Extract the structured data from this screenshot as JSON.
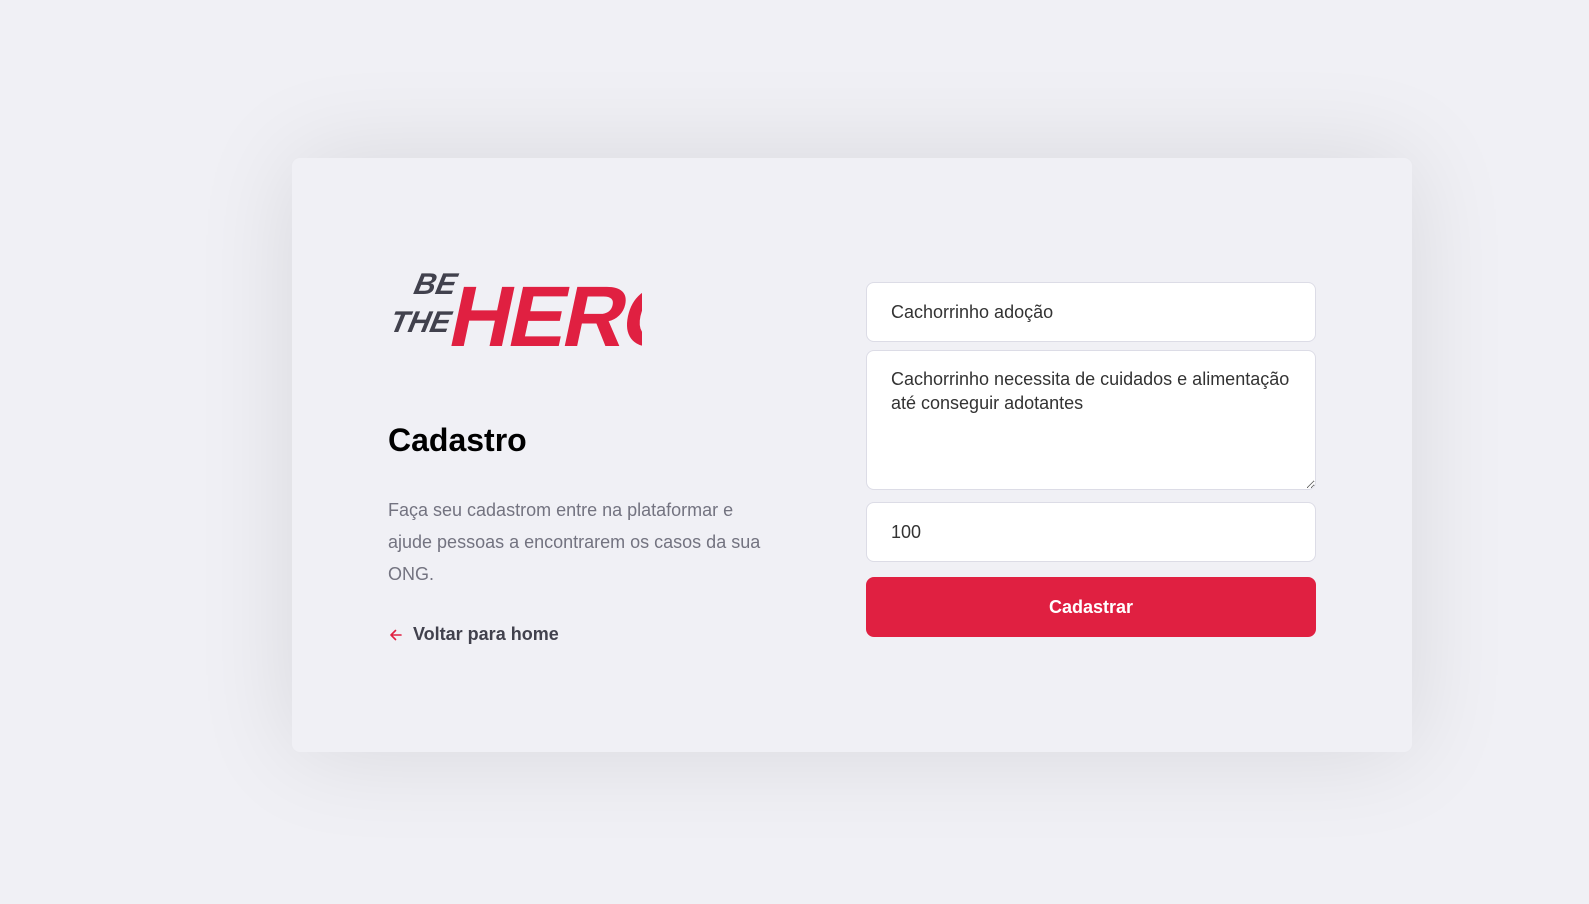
{
  "brand": {
    "logo_small_line1": "BE",
    "logo_small_line2": "THE",
    "logo_large": "HERO",
    "logo_dark_color": "#41414d",
    "logo_accent_color": "#e02041"
  },
  "page": {
    "title": "Cadastro",
    "description": "Faça seu cadastrom entre na plataformar e ajude pessoas a encontrarem os casos da sua ONG.",
    "back_link_label": "Voltar para home",
    "back_link_icon": "arrow-left-icon"
  },
  "form": {
    "title_value": "Cachorrinho adoção",
    "description_value": "Cachorrinho necessita de cuidados e alimentação até conseguir adotantes",
    "value_value": "100",
    "submit_label": "Cadastrar"
  },
  "colors": {
    "background": "#f0f0f5",
    "accent": "#e02041",
    "text_muted": "#737380",
    "text_dark": "#41414d"
  }
}
